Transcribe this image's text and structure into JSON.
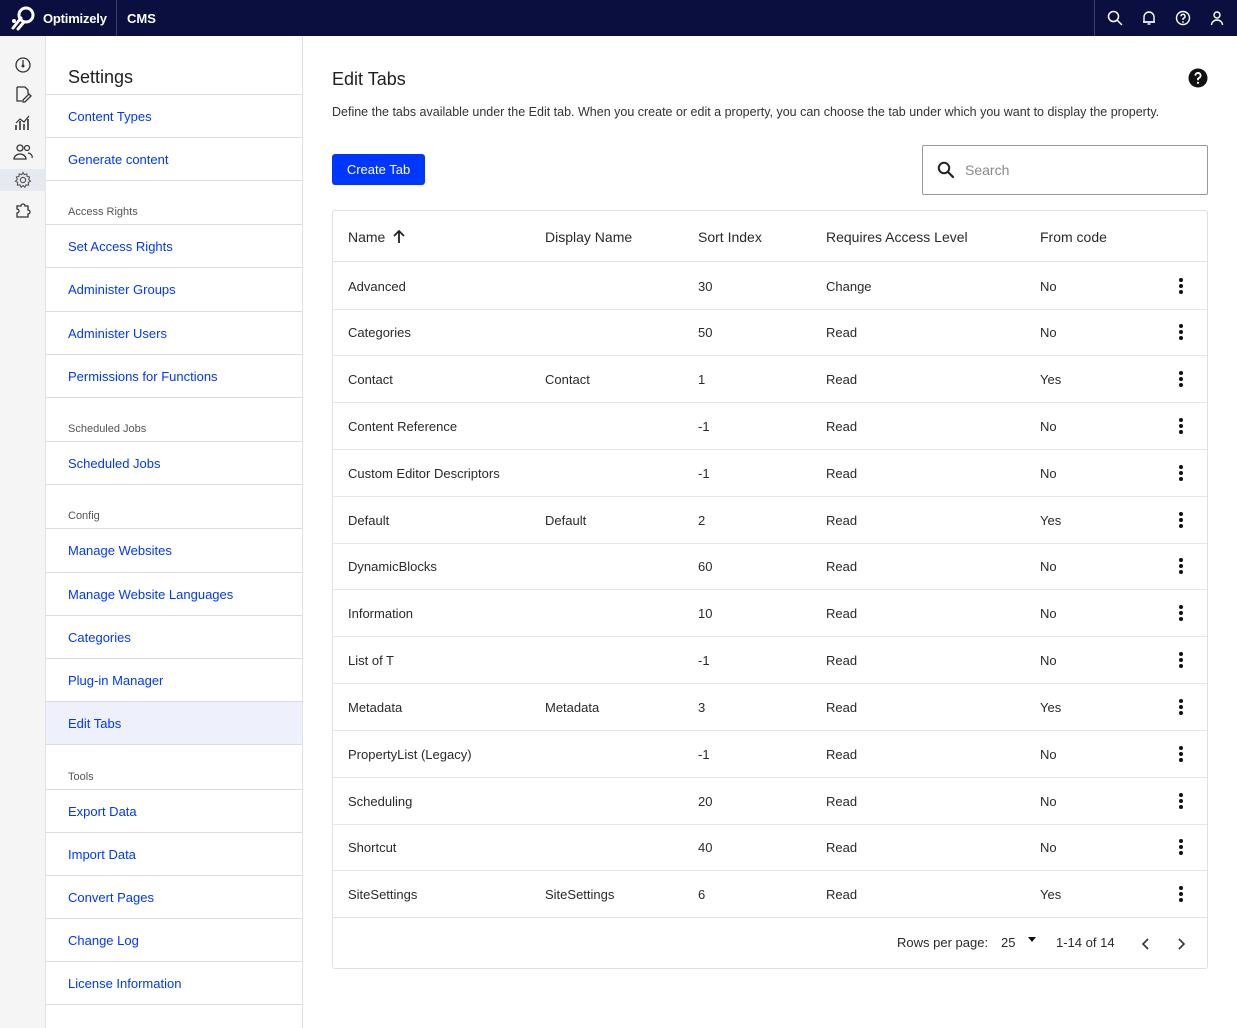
{
  "topbar": {
    "brand": "Optimizely",
    "product": "CMS",
    "actions": [
      "search-icon",
      "bell-icon",
      "help-icon",
      "user-icon"
    ]
  },
  "rail": {
    "items": [
      "dashboard-icon",
      "edit-icon",
      "analytics-icon",
      "users-icon",
      "settings-icon",
      "addons-icon"
    ],
    "active": "settings-icon"
  },
  "sidebar": {
    "title": "Settings",
    "items": [
      {
        "label": "Content Types"
      },
      {
        "label": "Generate content"
      },
      {
        "section": "Access Rights"
      },
      {
        "label": "Set Access Rights"
      },
      {
        "label": "Administer Groups"
      },
      {
        "label": "Administer Users"
      },
      {
        "label": "Permissions for Functions"
      },
      {
        "section": "Scheduled Jobs"
      },
      {
        "label": "Scheduled Jobs"
      },
      {
        "section": "Config"
      },
      {
        "label": "Manage Websites"
      },
      {
        "label": "Manage Website Languages"
      },
      {
        "label": "Categories"
      },
      {
        "label": "Plug-in Manager"
      },
      {
        "label": "Edit Tabs",
        "active": true
      },
      {
        "section": "Tools"
      },
      {
        "label": "Export Data"
      },
      {
        "label": "Import Data"
      },
      {
        "label": "Convert Pages"
      },
      {
        "label": "Change Log"
      },
      {
        "label": "License Information"
      }
    ]
  },
  "main": {
    "title": "Edit Tabs",
    "description": "Define the tabs available under the Edit tab. When you create or edit a property, you can choose the tab under which you want to display the property.",
    "create_button": "Create Tab",
    "search_placeholder": "Search",
    "columns": [
      "Name",
      "Display Name",
      "Sort Index",
      "Requires Access Level",
      "From code"
    ],
    "sort_column": "Name",
    "sort_direction": "ascending",
    "rows": [
      [
        "Advanced",
        "",
        "30",
        "Change",
        "No"
      ],
      [
        "Categories",
        "",
        "50",
        "Read",
        "No"
      ],
      [
        "Contact",
        "Contact",
        "1",
        "Read",
        "Yes"
      ],
      [
        "Content Reference",
        "",
        "-1",
        "Read",
        "No"
      ],
      [
        "Custom Editor Descriptors",
        "",
        "-1",
        "Read",
        "No"
      ],
      [
        "Default",
        "Default",
        "2",
        "Read",
        "Yes"
      ],
      [
        "DynamicBlocks",
        "",
        "60",
        "Read",
        "No"
      ],
      [
        "Information",
        "",
        "10",
        "Read",
        "No"
      ],
      [
        "List of T",
        "",
        "-1",
        "Read",
        "No"
      ],
      [
        "Metadata",
        "Metadata",
        "3",
        "Read",
        "Yes"
      ],
      [
        "PropertyList (Legacy)",
        "",
        "-1",
        "Read",
        "No"
      ],
      [
        "Scheduling",
        "",
        "20",
        "Read",
        "No"
      ],
      [
        "Shortcut",
        "",
        "40",
        "Read",
        "No"
      ],
      [
        "SiteSettings",
        "SiteSettings",
        "6",
        "Read",
        "Yes"
      ]
    ],
    "pagination": {
      "rows_per_page_label": "Rows per page:",
      "rows_per_page": "25",
      "range": "1-14 of 14"
    }
  },
  "colors": {
    "topbar": "#0b0f3f",
    "accent": "#0037ff",
    "active_item_bg": "#eef0fb"
  }
}
